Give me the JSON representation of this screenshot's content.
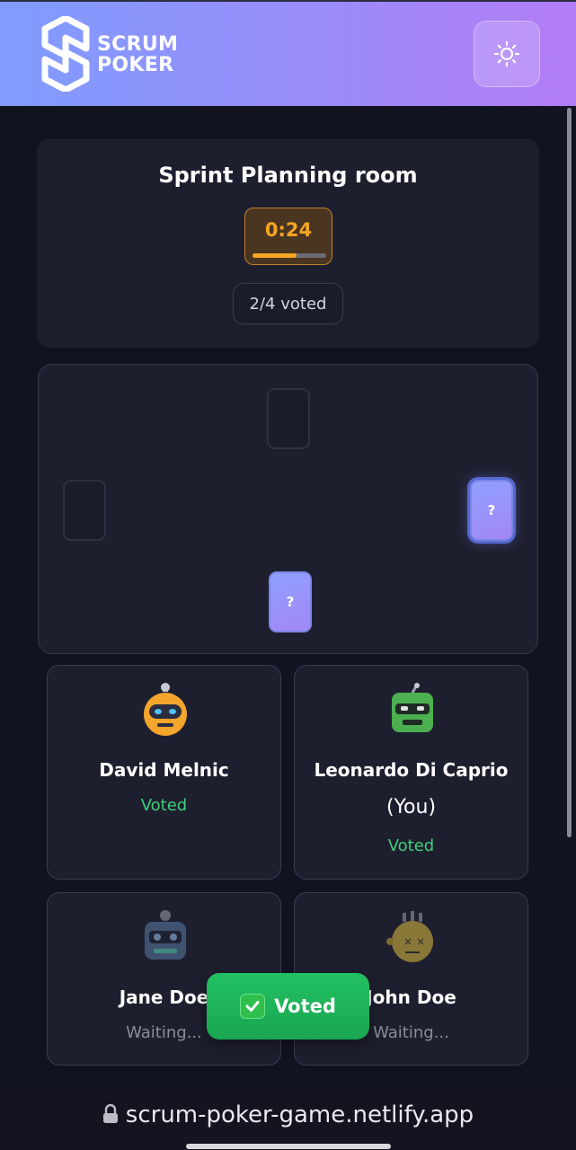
{
  "header": {
    "brand_line1": "SCRUM",
    "brand_line2": "POKER",
    "theme_toggle_icon": "sun-icon",
    "colors": {
      "gradient_start": "#7f9cff",
      "gradient_end": "#b27cf6"
    }
  },
  "room": {
    "title": "Sprint Planning room",
    "timer": "0:24",
    "timer_progress": 0.6,
    "voted_count": "2/4 voted"
  },
  "table": {
    "cards": [
      {
        "position": "top",
        "state": "empty",
        "label": ""
      },
      {
        "position": "left",
        "state": "empty",
        "label": ""
      },
      {
        "position": "right",
        "state": "filled",
        "label": "?"
      },
      {
        "position": "bottom",
        "state": "filled",
        "label": "?"
      }
    ]
  },
  "players": [
    {
      "name": "David Melnic",
      "you_label": "",
      "status": "Voted",
      "avatar": "yellow-robot-icon"
    },
    {
      "name": "Leonardo Di Caprio",
      "you_label": "(You)",
      "status": "Voted",
      "avatar": "green-robot-icon"
    },
    {
      "name": "Jane Doe",
      "you_label": "",
      "status": "Waiting...",
      "avatar": "blue-robot-icon"
    },
    {
      "name": "John Doe",
      "you_label": "",
      "status": "Waiting...",
      "avatar": "yellow-zombie-icon"
    }
  ],
  "toast": {
    "icon": "check-mark-icon",
    "text": "Voted"
  },
  "browser": {
    "url": "scrum-poker-game.netlify.app",
    "lock_icon": "lock-icon"
  },
  "colors": {
    "voted": "#3ecf7a",
    "waiting": "#8a8c9c",
    "timer": "#f5a623",
    "toast": "#22c062"
  }
}
